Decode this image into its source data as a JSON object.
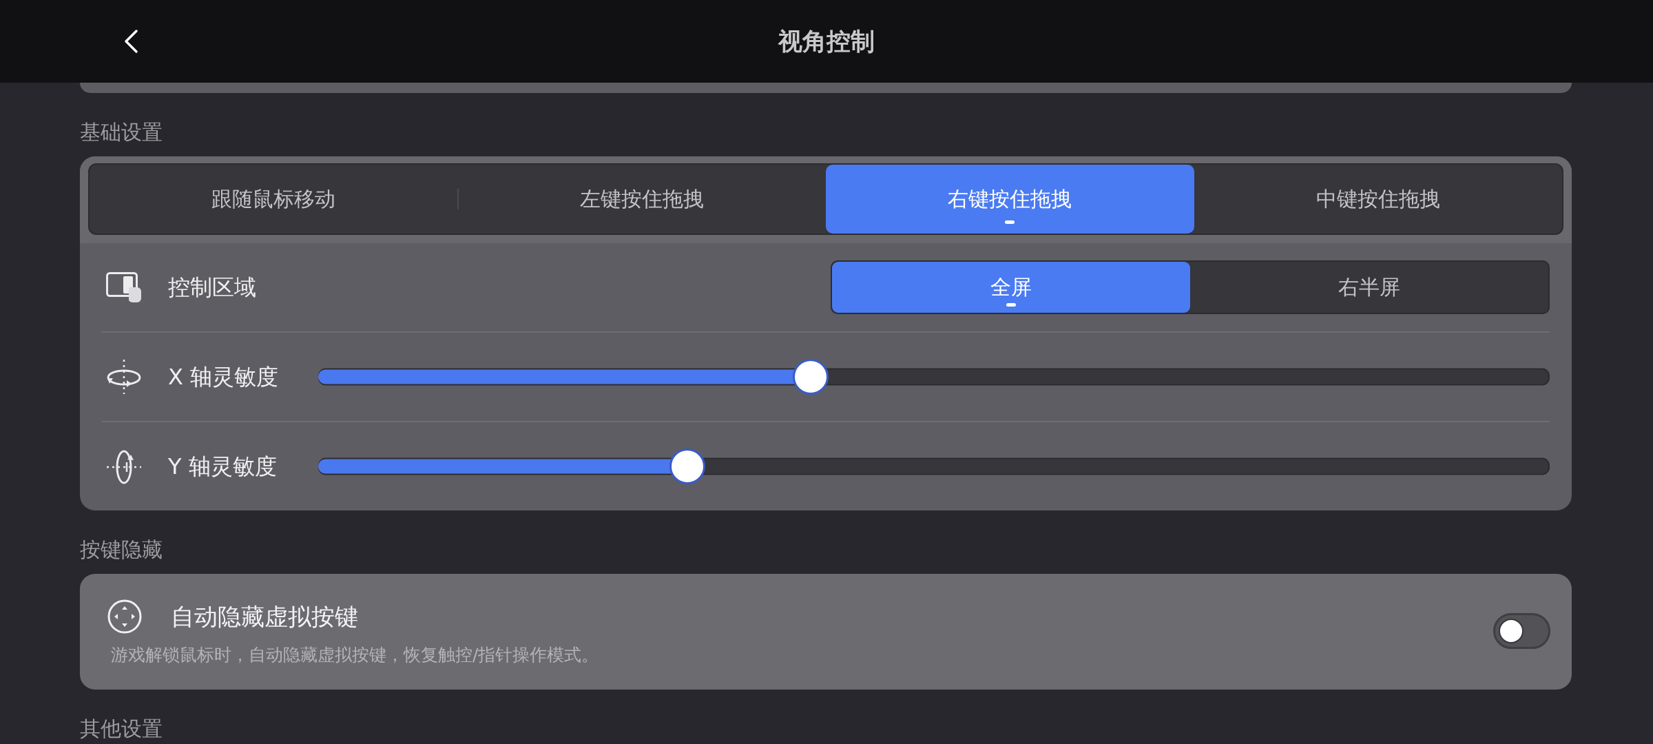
{
  "top_bar": {
    "title": "视角控制"
  },
  "basic_settings": {
    "heading": "基础设置",
    "mode_tabs": [
      {
        "label": "跟随鼠标移动",
        "selected": false
      },
      {
        "label": "左键按住拖拽",
        "selected": false
      },
      {
        "label": "右键按住拖拽",
        "selected": true
      },
      {
        "label": "中键按住拖拽",
        "selected": false
      }
    ],
    "control_area": {
      "label": "控制区域",
      "options": [
        {
          "label": "全屏",
          "selected": true
        },
        {
          "label": "右半屏",
          "selected": false
        }
      ]
    },
    "sliders": [
      {
        "label": "X 轴灵敏度",
        "level": 0.4
      },
      {
        "label": "Y 轴灵敏度",
        "level": 0.3
      }
    ]
  },
  "key_hiding": {
    "heading": "按键隐藏",
    "auto_hide": {
      "title": "自动隐藏虚拟按键",
      "description": "游戏解锁鼠标时，自动隐藏虚拟按键，恢复触控/指针操作模式。",
      "on": false
    }
  },
  "other_settings": {
    "heading": "其他设置"
  }
}
